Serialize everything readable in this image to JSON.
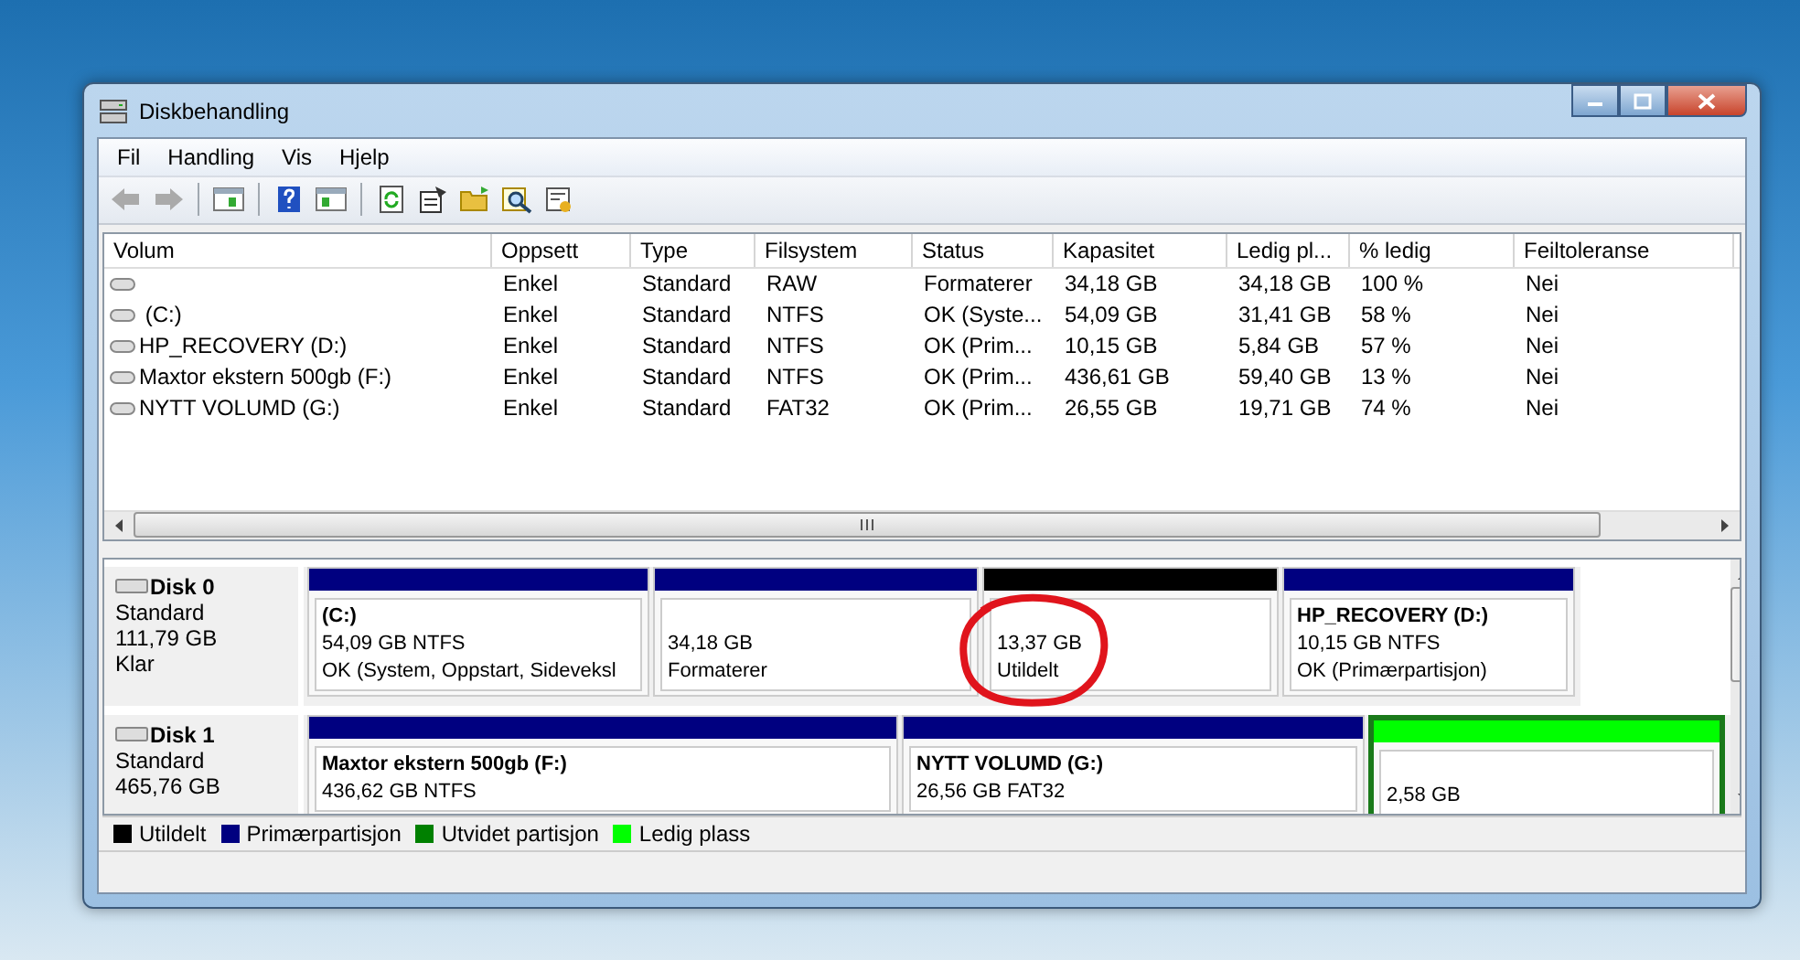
{
  "window": {
    "title": "Diskbehandling"
  },
  "menu": [
    "Fil",
    "Handling",
    "Vis",
    "Hjelp"
  ],
  "toolbar": [
    {
      "kind": "back",
      "disabled": true
    },
    {
      "kind": "forward",
      "disabled": true
    },
    {
      "kind": "sep"
    },
    {
      "kind": "pane"
    },
    {
      "kind": "sep"
    },
    {
      "kind": "help"
    },
    {
      "kind": "pane2"
    },
    {
      "kind": "sep"
    },
    {
      "kind": "refresh"
    },
    {
      "kind": "properties"
    },
    {
      "kind": "folder"
    },
    {
      "kind": "search"
    },
    {
      "kind": "settings"
    }
  ],
  "volume_table": {
    "columns": [
      "Volum",
      "Oppsett",
      "Type",
      "Filsystem",
      "Status",
      "Kapasitet",
      "Ledig pl...",
      "% ledig",
      "Feiltoleranse"
    ],
    "rows": [
      {
        "cells": [
          "",
          "Enkel",
          "Standard",
          "RAW",
          "Formaterer",
          "34,18 GB",
          "34,18 GB",
          "100 %",
          "Nei"
        ]
      },
      {
        "cells": [
          " (C:)",
          "Enkel",
          "Standard",
          "NTFS",
          "OK (Syste...",
          "54,09 GB",
          "31,41 GB",
          "58 %",
          "Nei"
        ]
      },
      {
        "cells": [
          "HP_RECOVERY (D:)",
          "Enkel",
          "Standard",
          "NTFS",
          "OK (Prim...",
          "10,15 GB",
          "5,84 GB",
          "57 %",
          "Nei"
        ]
      },
      {
        "cells": [
          "Maxtor ekstern 500gb (F:)",
          "Enkel",
          "Standard",
          "NTFS",
          "OK (Prim...",
          "436,61 GB",
          "59,40 GB",
          "13 %",
          "Nei"
        ]
      },
      {
        "cells": [
          "NYTT VOLUMD (G:)",
          "Enkel",
          "Standard",
          "FAT32",
          "OK (Prim...",
          "26,55 GB",
          "19,71 GB",
          "74 %",
          "Nei"
        ]
      }
    ]
  },
  "disks": [
    {
      "name": "Disk 0",
      "type": "Standard",
      "size": "111,79 GB",
      "status": "Klar",
      "partitions": [
        {
          "kind": "primary",
          "color": "#000080",
          "name": "(C:)",
          "size": "54,09 GB NTFS",
          "status": "OK (System, Oppstart, Sideveksl",
          "circled": false
        },
        {
          "kind": "primary",
          "color": "#000080",
          "size": "34,18 GB",
          "status": "Formaterer",
          "circled": false
        },
        {
          "kind": "unallocated",
          "color": "#000000",
          "size": "13,37 GB",
          "status": "Utildelt",
          "circled": true
        },
        {
          "kind": "primary",
          "color": "#000080",
          "name": "HP_RECOVERY  (D:)",
          "size": "10,15 GB NTFS",
          "status": "OK (Primærpartisjon)",
          "circled": false
        }
      ]
    },
    {
      "name": "Disk 1",
      "type": "Standard",
      "size": "465,76 GB",
      "partitions": [
        {
          "kind": "primary",
          "color": "#000080",
          "name": "Maxtor ekstern 500gb  (F:)",
          "size": "436,62 GB NTFS",
          "circled": false
        },
        {
          "kind": "primary",
          "color": "#000080",
          "name": "NYTT VOLUMD  (G:)",
          "size": "26,56 GB FAT32",
          "circled": false
        },
        {
          "kind": "free",
          "color": "#00ff00",
          "size": "2,58 GB",
          "circled": false
        }
      ]
    }
  ],
  "legend": [
    {
      "label": "Utildelt",
      "color": "#000000"
    },
    {
      "label": "Primærpartisjon",
      "color": "#000080"
    },
    {
      "label": "Utvidet partisjon",
      "color": "#008000"
    },
    {
      "label": "Ledig plass",
      "color": "#00ff00"
    }
  ]
}
